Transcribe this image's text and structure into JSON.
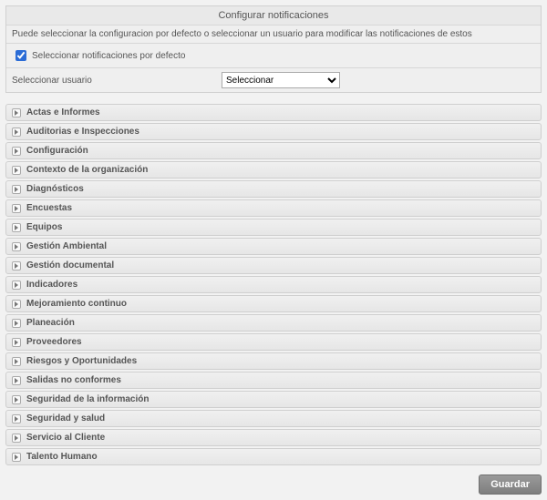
{
  "panel": {
    "title": "Configurar notificaciones",
    "description": "Puede seleccionar la configuracion por defecto o seleccionar un usuario para modificar las notificaciones de estos",
    "default_checkbox_label": "Seleccionar notificaciones por defecto",
    "default_checked": true,
    "user_label": "Seleccionar usuario",
    "user_select_placeholder": "Seleccionar"
  },
  "categories": [
    "Actas e Informes",
    "Auditorias e Inspecciones",
    "Configuración",
    "Contexto de la organización",
    "Diagnósticos",
    "Encuestas",
    "Equipos",
    "Gestión Ambiental",
    "Gestión documental",
    "Indicadores",
    "Mejoramiento continuo",
    "Planeación",
    "Proveedores",
    "Riesgos y Oportunidades",
    "Salidas no conformes",
    "Seguridad de la información",
    "Seguridad y salud",
    "Servicio al Cliente",
    "Talento Humano"
  ],
  "footer": {
    "save_label": "Guardar"
  }
}
